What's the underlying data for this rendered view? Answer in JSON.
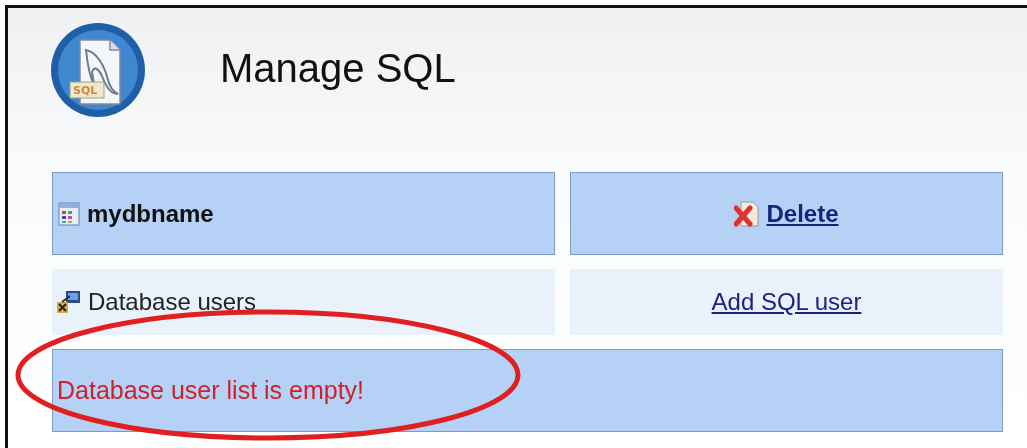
{
  "header": {
    "logo_label": "SQL",
    "title": "Manage SQL"
  },
  "database": {
    "name": "mydbname",
    "action": "Delete"
  },
  "users": {
    "label": "Database users",
    "action": "Add SQL user"
  },
  "message": {
    "text": "Database user list is empty!"
  },
  "annotation": {
    "kind": "ellipse",
    "color": "#e02020"
  }
}
